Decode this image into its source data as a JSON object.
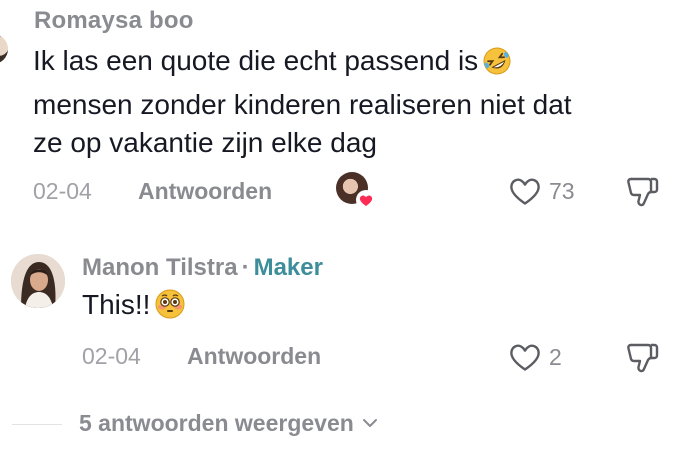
{
  "comment1": {
    "author": "Romaysa boo",
    "lines": [
      "Ik las een quote die echt passend is",
      "mensen zonder kinderen realiseren niet dat",
      "ze op vakantie zijn elke dag"
    ],
    "emoji": "rolling-on-floor-laughing-emoji",
    "date": "02-04",
    "reply_label": "Antwoorden",
    "liked_by_creator": true,
    "like_count": "73"
  },
  "comment2": {
    "author": "Manon Tilstra",
    "separator": "·",
    "badge": "Maker",
    "text": "This!!",
    "emoji": "flushed-face-emoji",
    "date": "02-04",
    "reply_label": "Antwoorden",
    "like_count": "2"
  },
  "view_replies": {
    "label": "5 antwoorden weergeven"
  },
  "colors": {
    "primary_text": "#161823",
    "secondary_text": "#8a8b91",
    "muted_text": "#a1a2a7",
    "maker_badge": "#3d8e9a",
    "heart_red": "#fe2c55"
  }
}
